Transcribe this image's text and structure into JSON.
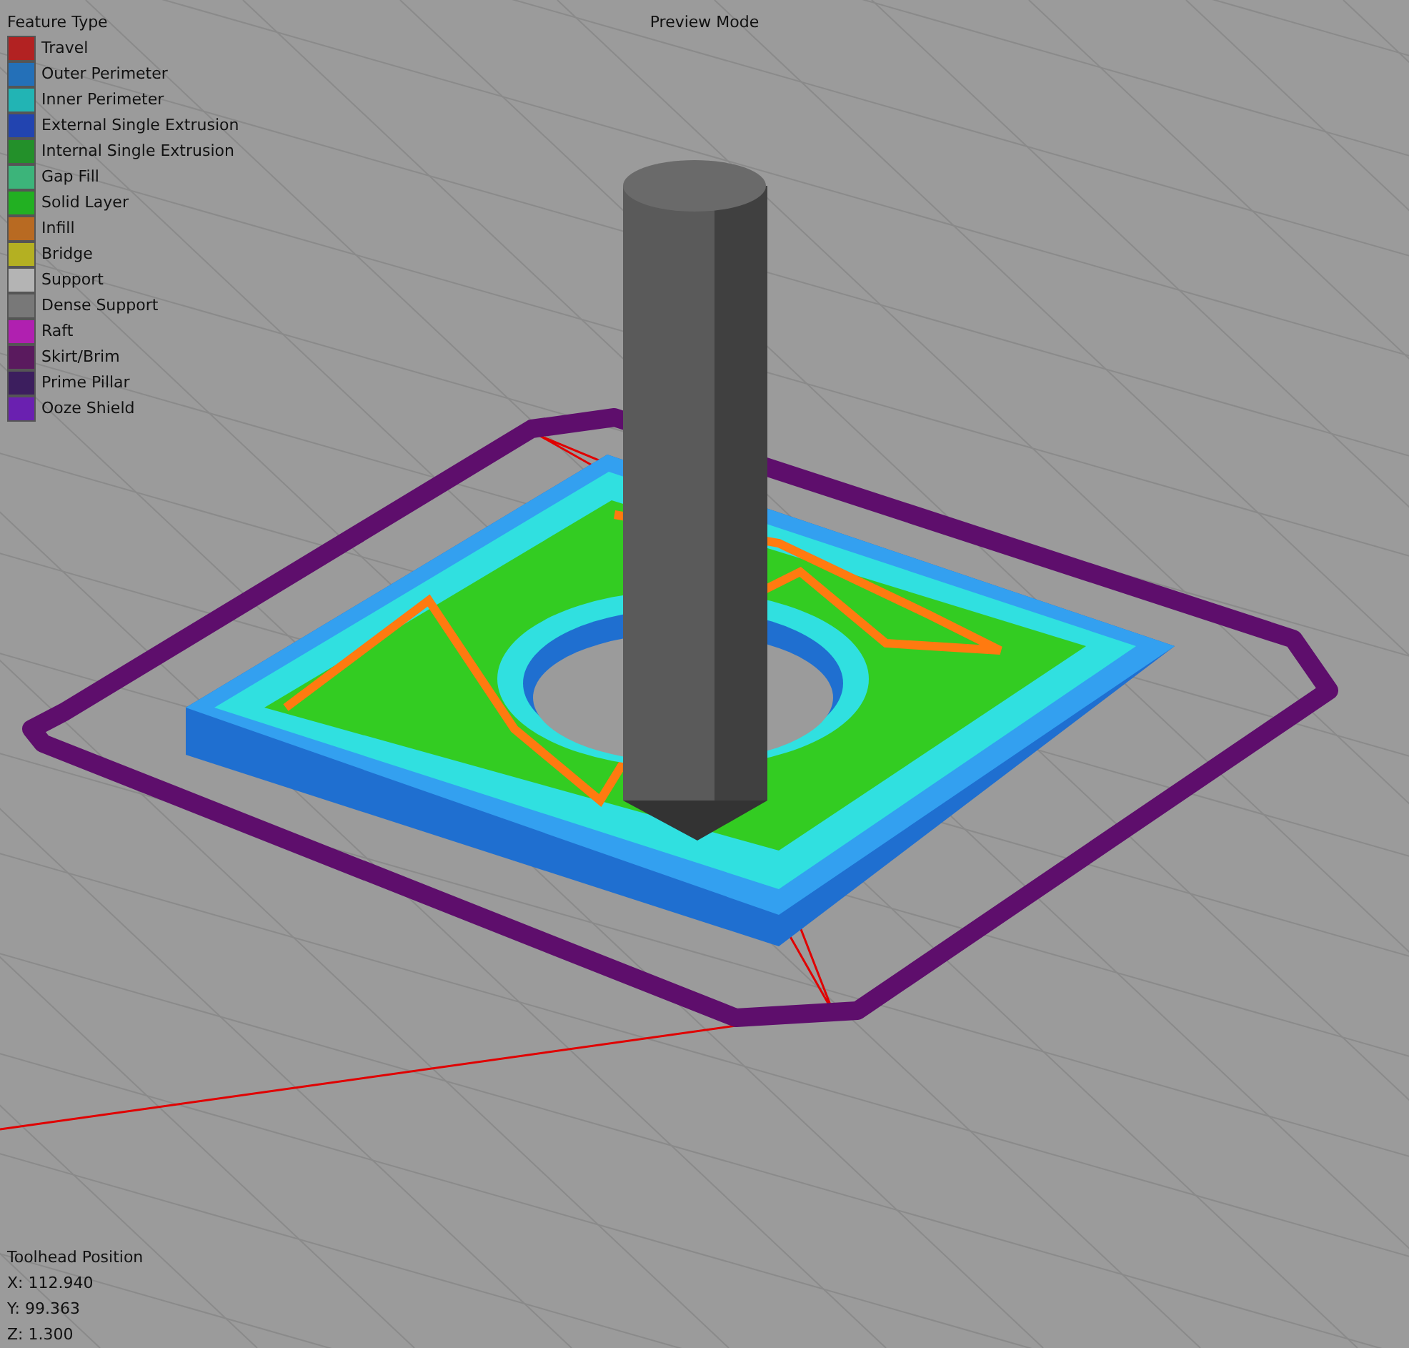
{
  "legend": {
    "title": "Feature Type",
    "items": [
      {
        "label": "Travel",
        "color": "#b22222"
      },
      {
        "label": "Outer Perimeter",
        "color": "#2470b8"
      },
      {
        "label": "Inner Perimeter",
        "color": "#22b4b4"
      },
      {
        "label": "External Single Extrusion",
        "color": "#2244b0"
      },
      {
        "label": "Internal Single Extrusion",
        "color": "#23902a"
      },
      {
        "label": "Gap Fill",
        "color": "#3cb47a"
      },
      {
        "label": "Solid Layer",
        "color": "#22b022"
      },
      {
        "label": "Infill",
        "color": "#b86a22"
      },
      {
        "label": "Bridge",
        "color": "#b4b022"
      },
      {
        "label": "Support",
        "color": "#b4b4b4"
      },
      {
        "label": "Dense Support",
        "color": "#787878"
      },
      {
        "label": "Raft",
        "color": "#b020b0"
      },
      {
        "label": "Skirt/Brim",
        "color": "#5a1a5e"
      },
      {
        "label": "Prime Pillar",
        "color": "#3c1e5e"
      },
      {
        "label": "Ooze Shield",
        "color": "#6a20b0"
      }
    ]
  },
  "mode_label": "Preview Mode",
  "toolhead": {
    "title": "Toolhead Position",
    "lines": [
      "X: 112.940",
      "Y: 99.363",
      "Z: 1.300"
    ]
  }
}
